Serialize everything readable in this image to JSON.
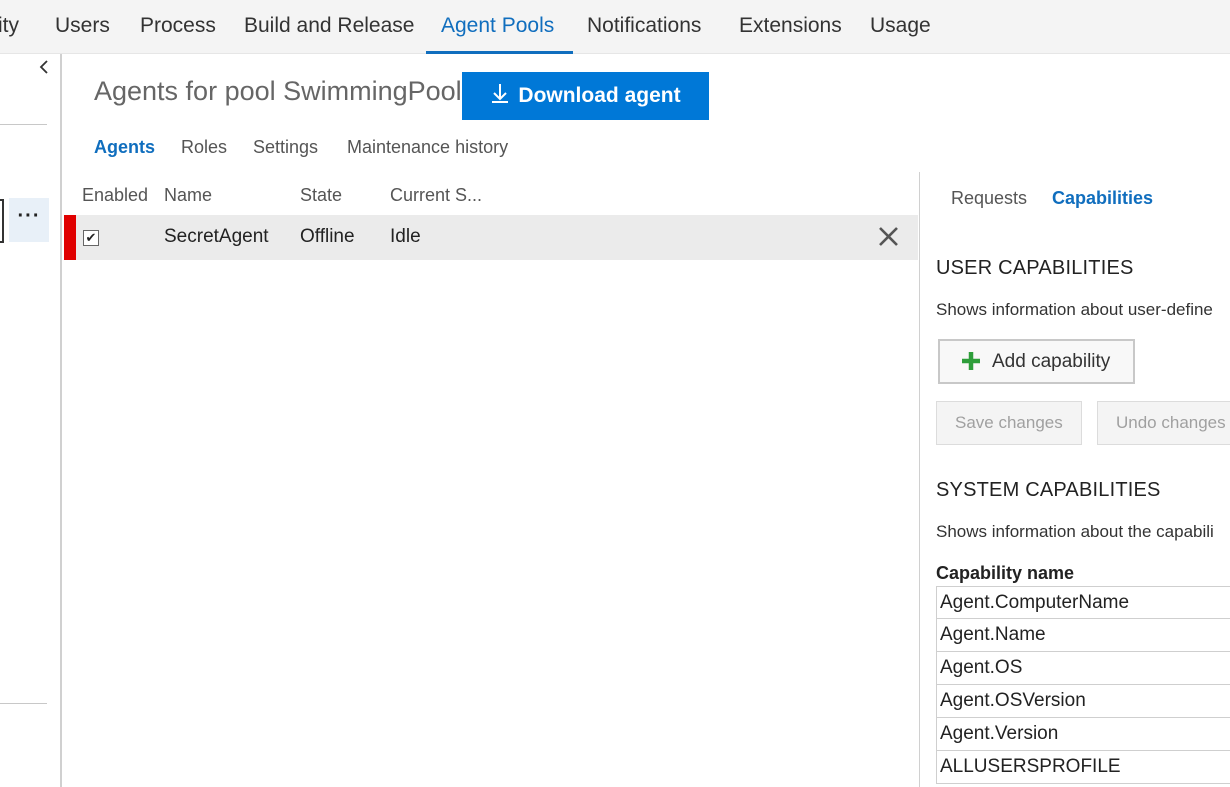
{
  "topnav": {
    "tabs": [
      {
        "label": "ity"
      },
      {
        "label": "Users"
      },
      {
        "label": "Process"
      },
      {
        "label": "Build and Release"
      },
      {
        "label": "Agent Pools",
        "active": true
      },
      {
        "label": "Notifications"
      },
      {
        "label": "Extensions"
      },
      {
        "label": "Usage"
      }
    ]
  },
  "sidebar": {
    "collapse_icon": "chevron-left-icon",
    "more_label": "···"
  },
  "header": {
    "title": "Agents for pool SwimmingPool",
    "download_label": "Download agent",
    "download_icon": "download-icon"
  },
  "subtabs": [
    {
      "label": "Agents",
      "active": true
    },
    {
      "label": "Roles"
    },
    {
      "label": "Settings"
    },
    {
      "label": "Maintenance history"
    }
  ],
  "grid": {
    "columns": [
      "Enabled",
      "Name",
      "State",
      "Current S..."
    ],
    "rows": [
      {
        "enabled": true,
        "name": "SecretAgent",
        "state": "Offline",
        "current_status": "Idle",
        "status_color": "#e00000"
      }
    ]
  },
  "right_panel": {
    "tabs": [
      {
        "label": "Requests"
      },
      {
        "label": "Capabilities",
        "active": true
      }
    ],
    "user_capabilities": {
      "heading": "USER CAPABILITIES",
      "description": "Shows information about user-define",
      "add_label": "Add capability",
      "save_label": "Save changes",
      "undo_label": "Undo changes"
    },
    "system_capabilities": {
      "heading": "SYSTEM CAPABILITIES",
      "description": "Shows information about the capabili",
      "column": "Capability name",
      "rows": [
        "Agent.ComputerName",
        "Agent.Name",
        "Agent.OS",
        "Agent.OSVersion",
        "Agent.Version",
        "ALLUSERSPROFILE"
      ]
    }
  },
  "colors": {
    "accent": "#106ebe",
    "primary_button": "#0078d7",
    "offline": "#e00000",
    "add_icon": "#2e9e3a"
  }
}
